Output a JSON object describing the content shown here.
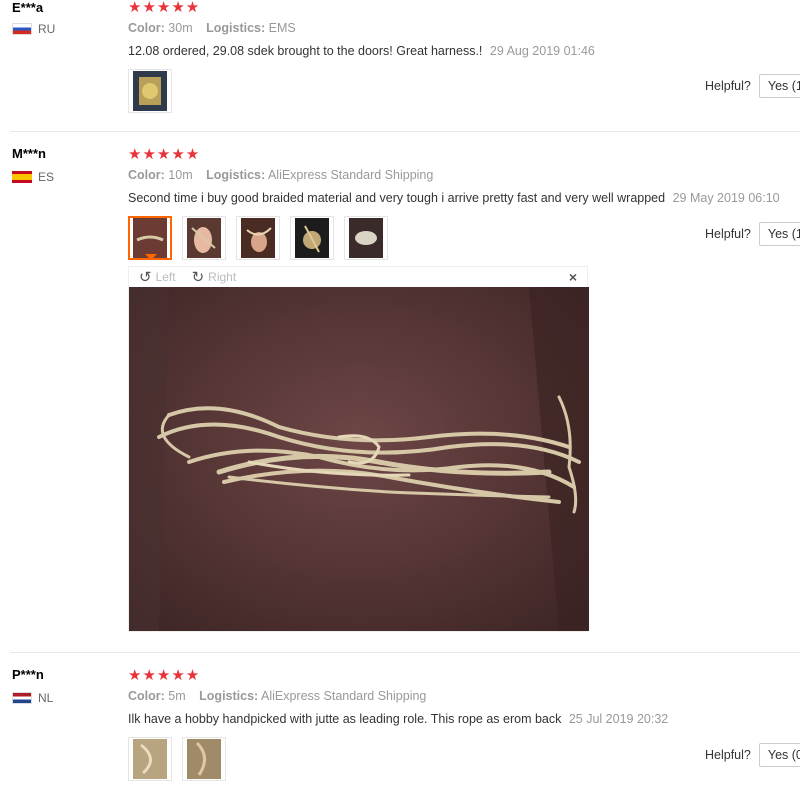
{
  "reviews": [
    {
      "user": "E***a",
      "country": "RU",
      "stars": "★★★★★",
      "color_label": "Color:",
      "color_value": "30m",
      "logistics_label": "Logistics:",
      "logistics_value": "EMS",
      "text": "12.08 ordered, 29.08 sdek brought to the doors! Great harness.!",
      "date": "29 Aug 2019 01:46",
      "helpful_label": "Helpful?",
      "yes_label": "Yes (1"
    },
    {
      "user": "M***n",
      "country": "ES",
      "stars": "★★★★★",
      "color_label": "Color:",
      "color_value": "10m",
      "logistics_label": "Logistics:",
      "logistics_value": "AliExpress Standard Shipping",
      "text": "Second time i buy good braided material and very tough i arrive pretty fast and very well wrapped",
      "date": "29 May 2019 06:10",
      "helpful_label": "Helpful?",
      "yes_label": "Yes (1"
    },
    {
      "user": "P***n",
      "country": "NL",
      "stars": "★★★★★",
      "color_label": "Color:",
      "color_value": "5m",
      "logistics_label": "Logistics:",
      "logistics_value": "AliExpress Standard Shipping",
      "text": "Ilk have a hobby handpicked with jutte as leading role. This rope as erom back",
      "date": "25 Jul 2019 20:32",
      "helpful_label": "Helpful?",
      "yes_label": "Yes (0"
    }
  ],
  "viewer": {
    "left_label": "Left",
    "right_label": "Right",
    "close": "×",
    "rotate_left_icon": "↺",
    "rotate_right_icon": "↻"
  },
  "colors": {
    "star": "#e8333a",
    "selected_thumb_border": "#ff6600"
  }
}
